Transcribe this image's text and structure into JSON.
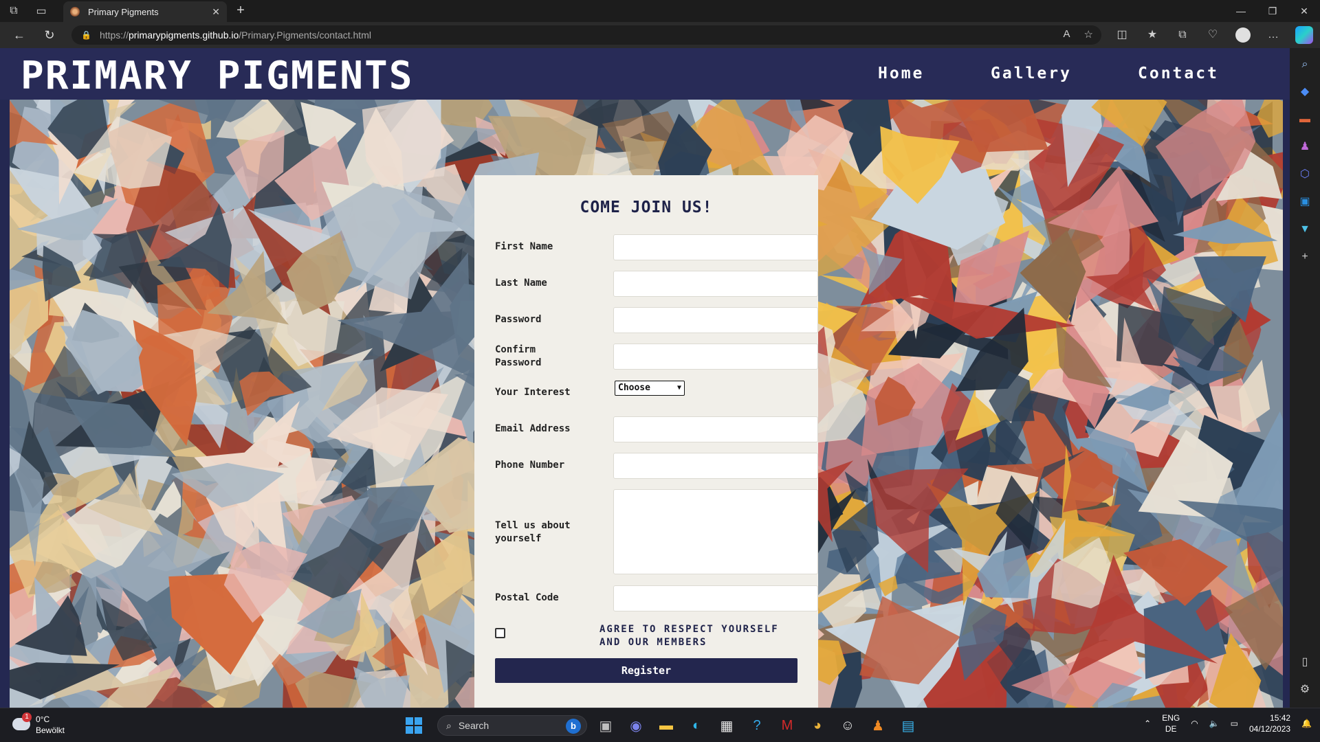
{
  "browser": {
    "tab_title": "Primary Pigments",
    "url_proto": "https://",
    "url_host": "primarypigments.github.io",
    "url_path": "/Primary.Pigments/contact.html"
  },
  "site": {
    "title": "PRIMARY PIGMENTS",
    "nav": [
      "Home",
      "Gallery",
      "Contact"
    ]
  },
  "form": {
    "title": "COME JOIN US!",
    "first_name_label": "First Name",
    "last_name_label": "Last Name",
    "password_label": "Password",
    "confirm_password_label": "Confirm Password",
    "interest_label": "Your Interest",
    "interest_selected": "Choose",
    "email_label": "Email Address",
    "phone_label": "Phone Number",
    "about_label": "Tell us about yourself",
    "postal_label": "Postal Code",
    "agree_text": "AGREE TO RESPECT YOURSELF AND OUR MEMBERS",
    "agree_checked": false,
    "register_label": "Register"
  },
  "taskbar": {
    "weather_temp": "0°C",
    "weather_desc": "Bewölkt",
    "weather_badge": "1",
    "search_placeholder": "Search",
    "lang_top": "ENG",
    "lang_bottom": "DE",
    "time": "15:42",
    "date": "04/12/2023"
  },
  "colors": {
    "header_bg": "#282b57",
    "card_bg": "#f1efe9",
    "button_bg": "#23264e"
  }
}
